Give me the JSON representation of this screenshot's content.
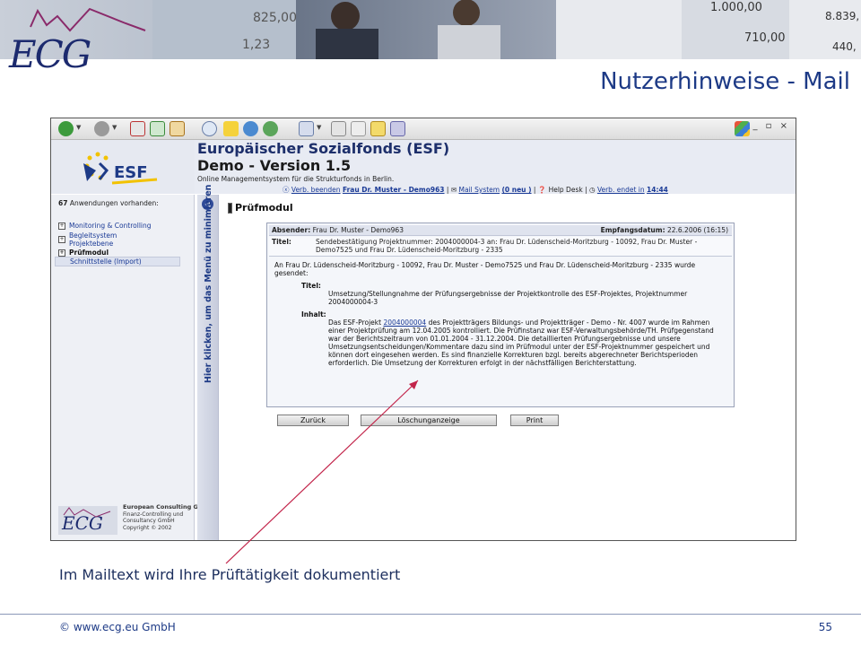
{
  "slide": {
    "logo": "ECG",
    "title": "Nutzerhinweise - Mail",
    "annotation": "Im Mailtext wird Ihre Prüftätigkeit dokumentiert",
    "footer_copyright": "© www.ecg.eu GmbH",
    "page_number": "55"
  },
  "app": {
    "logo_text": "ESF",
    "name": "Europäischer Sozialfonds (ESF)",
    "version": "Demo - Version 1.5",
    "subtitle": "Online Managementsystem für die Strukturfonds in Berlin.",
    "status": {
      "logout_link": "Verb. beenden",
      "user_link": "Frau Dr. Muster - Demo963",
      "mail_link": "Mail System",
      "mail_count": "(0 neu )",
      "helpdesk": "Help Desk",
      "session_link": "Verb. endet in",
      "session_time": "14:44"
    }
  },
  "sidebar": {
    "count_number": "67",
    "count_text": "Anwendungen vorhanden:",
    "items": [
      {
        "label": "Monitoring & Controlling"
      },
      {
        "label": "Begleitsystem"
      },
      {
        "label": "Projektebene"
      },
      {
        "label": "Prüfmodul"
      }
    ],
    "selected_item": "Schnittstelle (Import)",
    "collapse_hint": "Hier klicken, um das Menü zu minimieren",
    "company_name": "European Consulting Group",
    "company_line1": "Finanz-Controlling und",
    "company_line2": "Consultancy GmbH",
    "company_line3": "Copyright © 2002"
  },
  "main": {
    "section_title": "Prüfmodul",
    "message": {
      "sender_label": "Absender:",
      "sender": "Frau Dr. Muster - Demo963",
      "date_label": "Empfangsdatum:",
      "date": "22.6.2006 (16:15)",
      "title_label": "Titel:",
      "title": "Sendebestätigung Projektnummer: 2004000004-3 an: Frau Dr. Lüdenscheid-Moritzburg - 10092, Frau Dr. Muster - Demo7525 und Frau Dr. Lüdenscheid-Moritzburg - 2335",
      "intro": "An Frau Dr. Lüdenscheid-Moritzburg - 10092, Frau Dr. Muster - Demo7525 und Frau Dr. Lüdenscheid-Moritzburg - 2335 wurde gesendet:",
      "inner_title_label": "Titel:",
      "inner_title": "Umsetzung/Stellungnahme der Prüfungsergebnisse der Projektkontrolle des ESF-Projektes, Projektnummer 2004000004-3",
      "content_label": "Inhalt:",
      "content_pre": "Das ESF-Projekt",
      "content_link": "2004000004",
      "content_post": "des Projektträgers Bildungs- und Projektträger - Demo - Nr. 4007 wurde im Rahmen einer Projektprüfung am 12.04.2005 kontrolliert. Die Prüfinstanz war ESF-Verwaltungsbehörde/TH. Prüfgegenstand war der Berichtszeitraum von 01.01.2004 - 31.12.2004. Die detaillierten Prüfungsergebnisse und unsere Umsetzungsentscheidungen/Kommentare dazu sind im Prüfmodul unter der ESF-Projektnummer gespeichert und können dort eingesehen werden. Es sind finanzielle Korrekturen bzgl. bereits abgerechneter Berichtsperioden erforderlich. Die Umsetzung der Korrekturen erfolgt in der nächstfälligen Berichterstattung."
    },
    "buttons": {
      "back": "Zurück",
      "delete": "Löschunganzeige",
      "print": "Print"
    }
  }
}
